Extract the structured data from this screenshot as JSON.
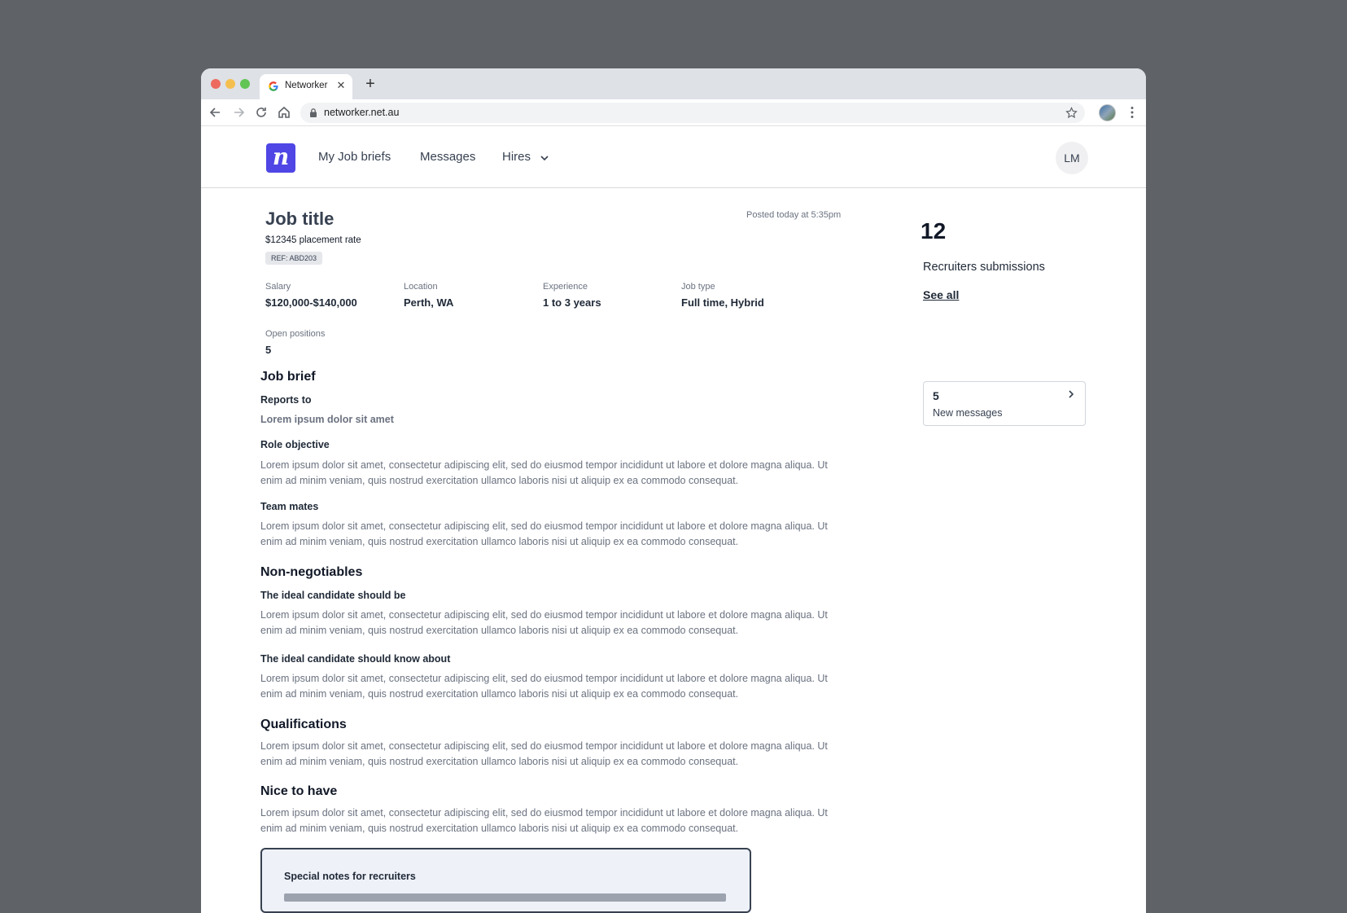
{
  "browser": {
    "tab_title": "Networker",
    "close_glyph": "✕",
    "new_tab_glyph": "+",
    "url": "networker.net.au"
  },
  "header": {
    "logo_letter": "n",
    "nav": [
      "My Job briefs",
      "Messages",
      "Hires"
    ],
    "user_initials": "LM"
  },
  "job": {
    "title": "Job title",
    "posted": "Posted today at 5:35pm",
    "rate": "$12345 placement rate",
    "ref": "REF: ABD203",
    "details": {
      "salary": {
        "label": "Salary",
        "value": "$120,000-$140,000"
      },
      "location": {
        "label": "Location",
        "value": "Perth, WA"
      },
      "experience": {
        "label": "Experience",
        "value": "1 to 3 years"
      },
      "job_type": {
        "label": "Job type",
        "value": "Full time, Hybrid"
      },
      "positions": {
        "label": "Open positions",
        "value": "5"
      }
    }
  },
  "brief": {
    "heading": "Job brief",
    "reports_to_label": "Reports to",
    "reports_to_value": "Lorem ipsum dolor sit amet",
    "role_objective_label": "Role objective",
    "role_objective_text": "Lorem ipsum dolor sit amet, consectetur adipiscing elit, sed do eiusmod tempor incididunt ut labore et dolore magna aliqua. Ut enim ad minim veniam, quis nostrud exercitation ullamco laboris nisi ut aliquip ex ea commodo consequat.",
    "team_mates_label": "Team mates",
    "team_mates_text": "Lorem ipsum dolor sit amet, consectetur adipiscing elit, sed do eiusmod tempor incididunt ut labore et dolore magna aliqua. Ut enim ad minim veniam, quis nostrud exercitation ullamco laboris nisi ut aliquip ex ea commodo consequat."
  },
  "non_negotiables": {
    "heading": "Non-negotiables",
    "should_be_label": "The ideal candidate should be",
    "should_be_text": "Lorem ipsum dolor sit amet, consectetur adipiscing elit, sed do eiusmod tempor incididunt ut labore et dolore magna aliqua. Ut enim ad minim veniam, quis nostrud exercitation ullamco laboris nisi ut aliquip ex ea commodo consequat.",
    "should_know_label": "The ideal candidate should know about",
    "should_know_text": "Lorem ipsum dolor sit amet, consectetur adipiscing elit, sed do eiusmod tempor incididunt ut labore et dolore magna aliqua. Ut enim ad minim veniam, quis nostrud exercitation ullamco laboris nisi ut aliquip ex ea commodo consequat."
  },
  "qualifications": {
    "heading": "Qualifications",
    "text": "Lorem ipsum dolor sit amet, consectetur adipiscing elit, sed do eiusmod tempor incididunt ut labore et dolore magna aliqua. Ut enim ad minim veniam, quis nostrud exercitation ullamco laboris nisi ut aliquip ex ea commodo consequat."
  },
  "nice_to_have": {
    "heading": "Nice to have",
    "text": "Lorem ipsum dolor sit amet, consectetur adipiscing elit, sed do eiusmod tempor incididunt ut labore et dolore magna aliqua. Ut enim ad minim veniam, quis nostrud exercitation ullamco laboris nisi ut aliquip ex ea commodo consequat."
  },
  "notes": {
    "title": "Special notes for recruiters"
  },
  "sidebar": {
    "count": "12",
    "label": "Recruiters submissions",
    "see_all": "See all",
    "messages_count": "5",
    "messages_label": "New messages"
  },
  "colors": {
    "brand": "#4f46e5",
    "backdrop": "#5f6368"
  },
  "icons": [
    "google-favicon",
    "back-arrow-icon",
    "forward-arrow-icon",
    "reload-icon",
    "home-icon",
    "lock-icon",
    "star-icon",
    "more-vert-icon",
    "chevron-down-icon",
    "chevron-right-icon"
  ]
}
